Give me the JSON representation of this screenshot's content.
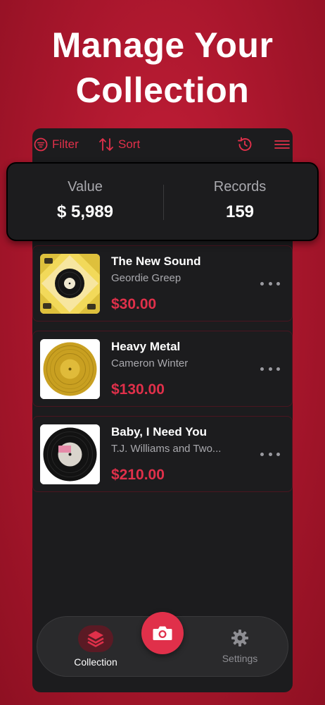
{
  "headline": {
    "line1": "Manage Your",
    "line2": "Collection"
  },
  "toolbar": {
    "filter_label": "Filter",
    "sort_label": "Sort"
  },
  "stats": {
    "value_label": "Value",
    "value_amount": "$ 5,989",
    "records_label": "Records",
    "records_count": "159"
  },
  "records": [
    {
      "title": "The New Sound",
      "artist": "Geordie Greep",
      "price": "$30.00",
      "cover": "yellow-pattern-vinyl"
    },
    {
      "title": "Heavy Metal",
      "artist": "Cameron Winter",
      "price": "$130.00",
      "cover": "gold-record"
    },
    {
      "title": "Baby, I Need You",
      "artist": "T.J. Williams and Two...",
      "price": "$210.00",
      "cover": "black-vinyl-pink-label"
    }
  ],
  "tabbar": {
    "collection_label": "Collection",
    "settings_label": "Settings"
  },
  "colors": {
    "accent": "#e0304a",
    "background": "#b01a30",
    "panel": "#1c1c1e"
  },
  "icons": [
    "filter-icon",
    "sort-icon",
    "history-icon",
    "menu-icon",
    "more-icon",
    "layers-icon",
    "camera-icon",
    "gear-icon"
  ]
}
